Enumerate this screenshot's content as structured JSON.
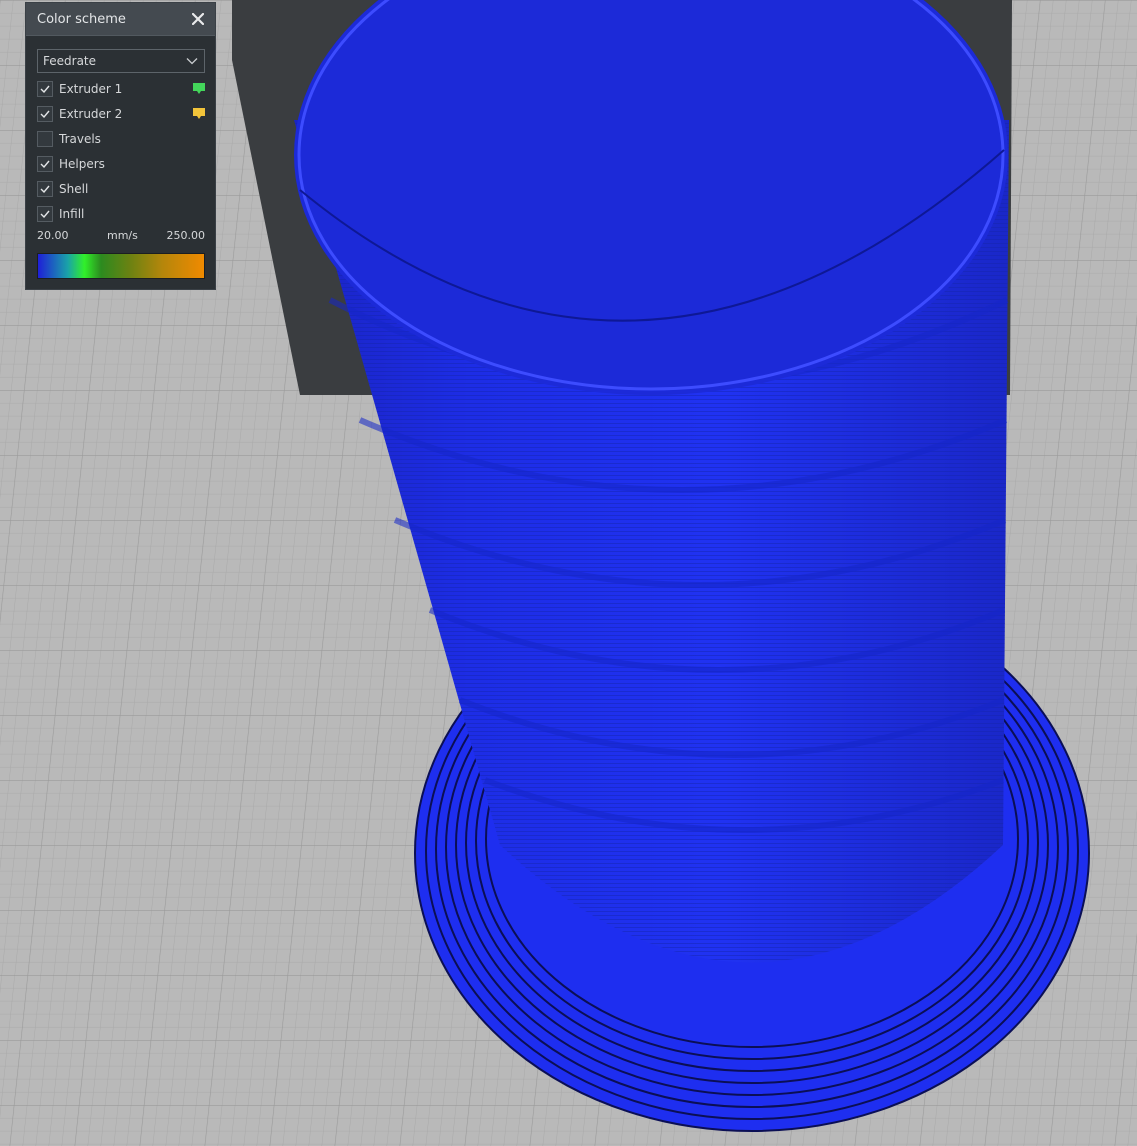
{
  "panel": {
    "title": "Color scheme",
    "close_icon": "close-icon",
    "scheme_select": {
      "selected": "Feedrate",
      "icon": "chevron-down-icon"
    },
    "options": [
      {
        "label": "Extruder 1",
        "checked": true,
        "color": "#43d65a"
      },
      {
        "label": "Extruder 2",
        "checked": true,
        "color": "#f2c43a"
      },
      {
        "label": "Travels",
        "checked": false
      },
      {
        "label": "Helpers",
        "checked": true
      },
      {
        "label": "Shell",
        "checked": true
      },
      {
        "label": "Infill",
        "checked": true
      }
    ],
    "legend": {
      "min": "20.00",
      "unit": "mm/s",
      "max": "250.00"
    }
  },
  "colors": {
    "build_plate": "#b9b9b9",
    "grid_line": "#a7a7a7",
    "print_blue": "#1e2ef0",
    "panel_bg": "#2b3034"
  }
}
